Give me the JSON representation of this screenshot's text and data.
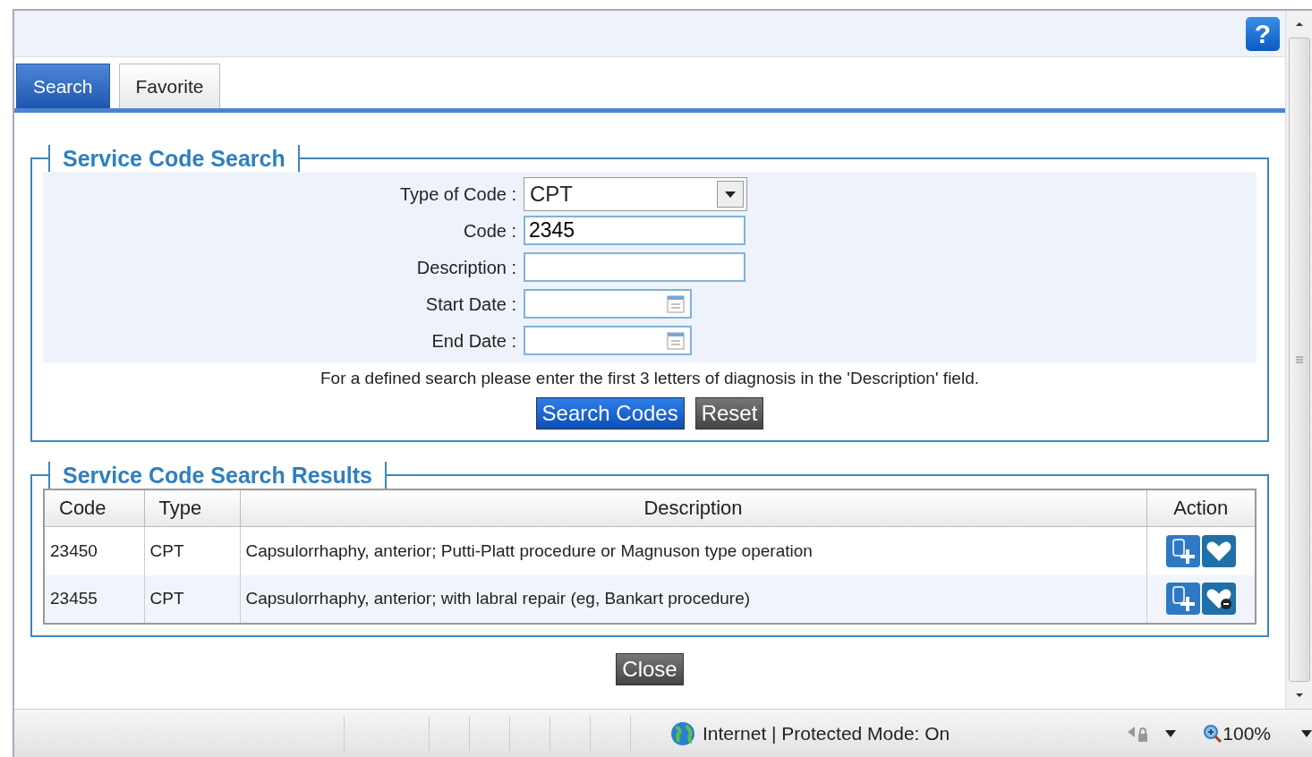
{
  "help_button": "?",
  "tabs": [
    {
      "label": "Search",
      "selected": true
    },
    {
      "label": "Favorite",
      "selected": false
    }
  ],
  "search_panel": {
    "title": "Service Code Search",
    "fields": [
      {
        "kind": "select",
        "label": "Type of Code :",
        "value": "CPT"
      },
      {
        "kind": "text",
        "label": "Code :",
        "value": "2345"
      },
      {
        "kind": "text",
        "label": "Description :"
      },
      {
        "kind": "date",
        "label": "Start Date :"
      },
      {
        "kind": "date",
        "label": "End Date :"
      }
    ],
    "hint": "For a defined search please enter the first 3 letters of diagnosis in the 'Description' field.",
    "buttons": [
      {
        "label": "Search Codes",
        "kind": "primary"
      },
      {
        "label": "Reset",
        "kind": "secondary"
      }
    ]
  },
  "results": {
    "title": "Service Code Search Results",
    "columns": [
      "Code",
      "Type",
      "Description",
      "Action"
    ],
    "rows": [
      {
        "code": "23450",
        "type": "CPT",
        "description": "Capsulorrhaphy, anterior; Putti-Platt procedure or Magnuson type operation",
        "favorite": false
      },
      {
        "code": "23455",
        "type": "CPT",
        "description": "Capsulorrhaphy, anterior; with labral repair (eg, Bankart procedure)",
        "favorite": true
      }
    ]
  },
  "close_button": "Close",
  "status_bar": {
    "zone": "Internet | Protected Mode: On",
    "zoom": "100%"
  }
}
